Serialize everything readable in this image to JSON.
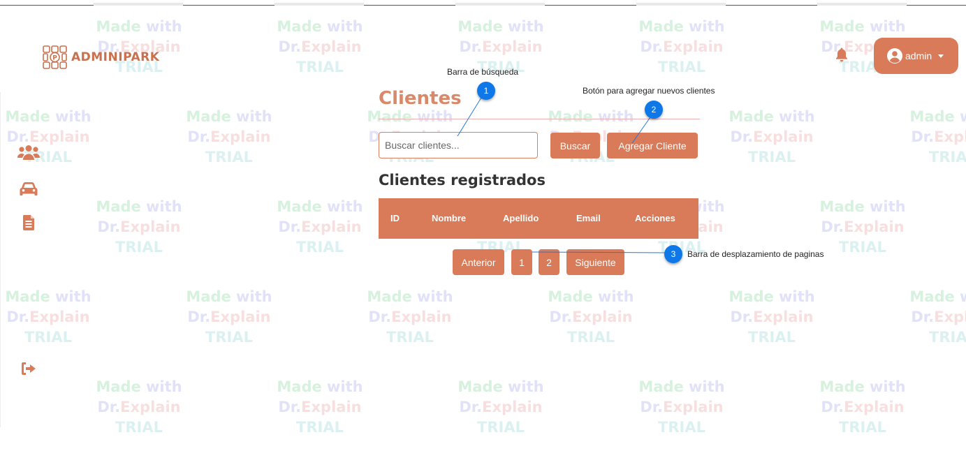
{
  "app": {
    "brand": "ADMINIPARK"
  },
  "header": {
    "user_label": "admin"
  },
  "sidebar": {
    "items": [
      {
        "icon": "users-icon"
      },
      {
        "icon": "car-icon"
      },
      {
        "icon": "document-icon"
      },
      {
        "icon": "logout-icon"
      }
    ]
  },
  "main": {
    "title": "Clientes",
    "search": {
      "placeholder": "Buscar clientes...",
      "button": "Buscar"
    },
    "add_button": "Agregar Cliente",
    "section_title": "Clientes registrados",
    "table": {
      "columns": [
        "ID",
        "Nombre",
        "Apellido",
        "Email",
        "Acciones"
      ]
    },
    "pagination": {
      "prev": "Anterior",
      "pages": [
        "1",
        "2"
      ],
      "next": "Siguiente"
    }
  },
  "callouts": [
    {
      "number": "1",
      "label": "Barra de búsqueda"
    },
    {
      "number": "2",
      "label": "Botón para agregar nuevos clientes"
    },
    {
      "number": "3",
      "label": "Barra de desplazamiento de paginas"
    }
  ],
  "watermark": {
    "line1a": "Made",
    "line1b": "with",
    "line2a": "Dr.",
    "line2b": "Explain",
    "line3": "TRIAL"
  },
  "colors": {
    "accent": "#d97a58",
    "callout": "#0f78e8",
    "title": "#d8896a"
  }
}
